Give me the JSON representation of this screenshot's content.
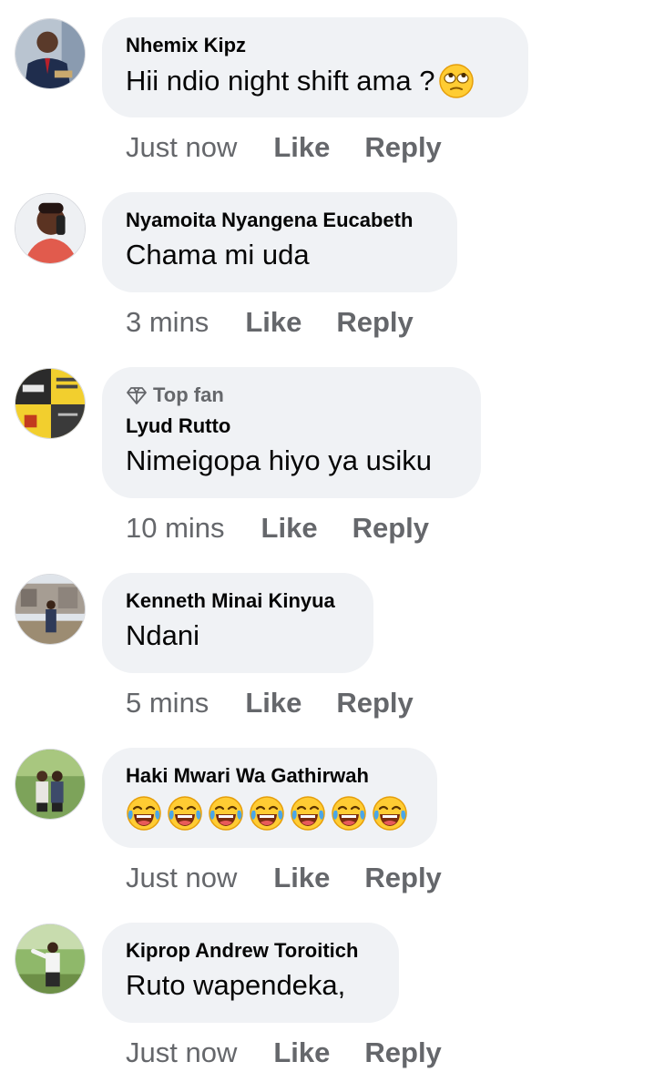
{
  "comments": [
    {
      "name": "Nhemix Kipz",
      "text": "Hii ndio night shift ama ?",
      "time": "Just now",
      "like": "Like",
      "reply": "Reply",
      "emoji": "face-with-rolling-eyes"
    },
    {
      "name": "Nyamoita Nyangena Eucabeth",
      "text": "Chama mi uda",
      "time": "3 mins",
      "like": "Like",
      "reply": "Reply"
    },
    {
      "badge": "Top fan",
      "name": "Lyud Rutto",
      "text": "Nimeigopa hiyo ya usiku",
      "time": "10 mins",
      "like": "Like",
      "reply": "Reply"
    },
    {
      "name": "Kenneth Minai Kinyua",
      "text": "Ndani",
      "time": "5 mins",
      "like": "Like",
      "reply": "Reply"
    },
    {
      "name": "Haki Mwari Wa Gathirwah",
      "text": "",
      "time": "Just now",
      "like": "Like",
      "reply": "Reply",
      "emoji": "face-with-tears-of-joy",
      "emoji_count": 7
    },
    {
      "name": "Kiprop Andrew Toroitich",
      "text": "Ruto wapendeka,",
      "time": "Just now",
      "like": "Like",
      "reply": "Reply"
    }
  ],
  "colors": {
    "bubble": "#f0f2f5",
    "meta": "#65676b",
    "text": "#050505"
  }
}
